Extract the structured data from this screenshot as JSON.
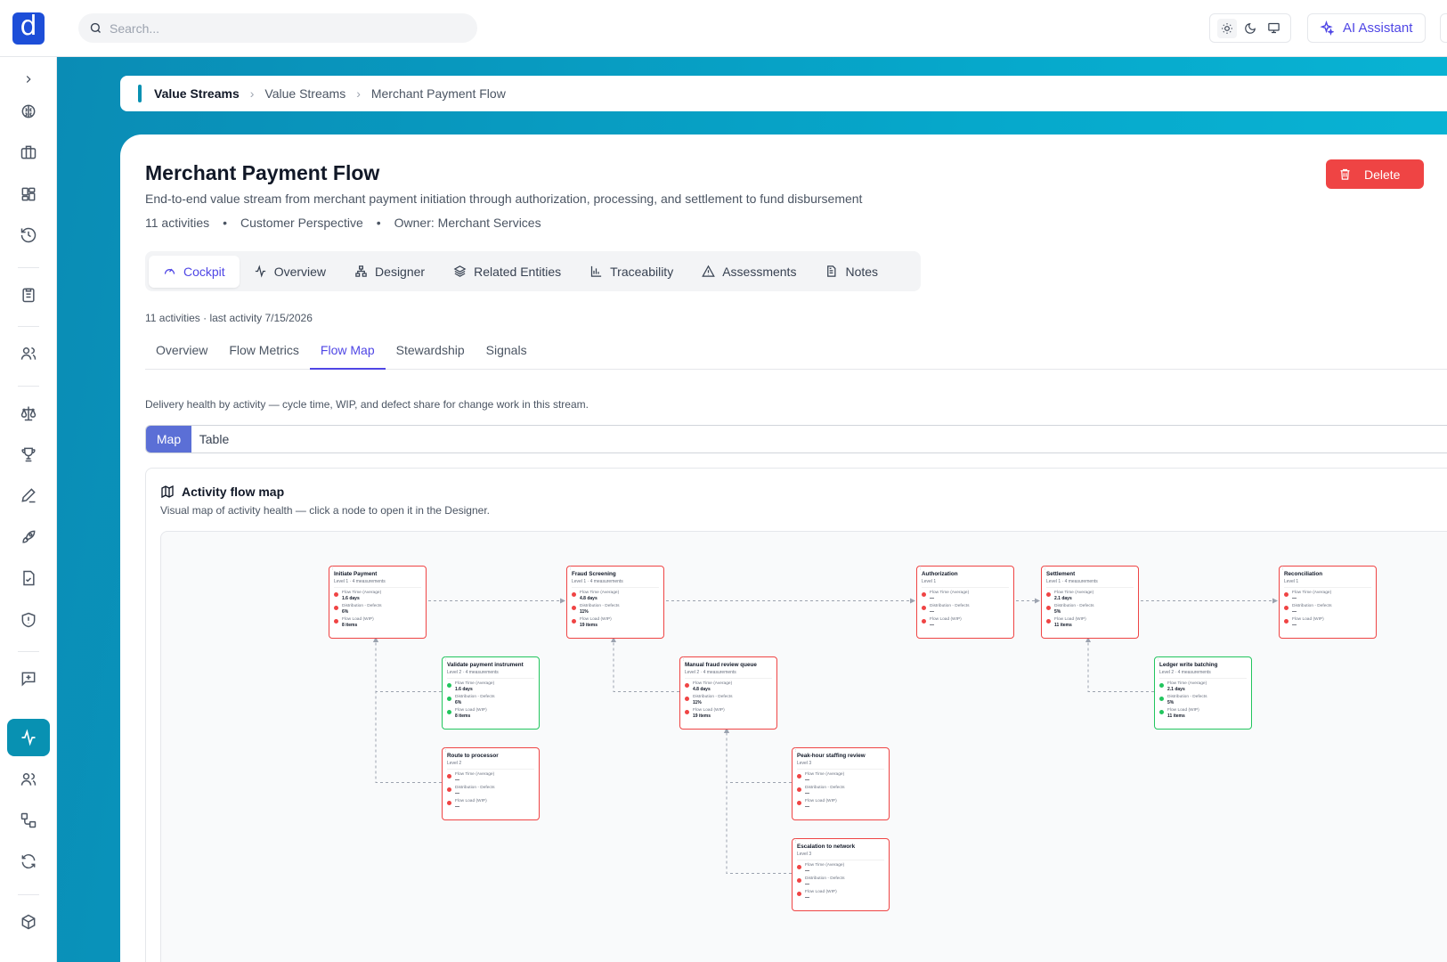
{
  "logo_letter": "d",
  "search": {
    "placeholder": "Search..."
  },
  "ai_assistant_label": "AI Assistant",
  "breadcrumb": {
    "root": "Value Streams",
    "items": [
      "Value Streams",
      "Merchant Payment Flow"
    ]
  },
  "page": {
    "title": "Merchant Payment Flow",
    "description": "End-to-end value stream from merchant payment initiation through authorization, processing, and settlement to fund disbursement",
    "meta": {
      "activities": "11 activities",
      "perspective": "Customer Perspective",
      "owner": "Owner: Merchant Services",
      "separator": "•"
    },
    "delete_label": "Delete"
  },
  "main_tabs": [
    {
      "label": "Cockpit",
      "icon": "gauge-icon",
      "active": true
    },
    {
      "label": "Overview",
      "icon": "activity-icon"
    },
    {
      "label": "Designer",
      "icon": "hierarchy-icon"
    },
    {
      "label": "Related Entities",
      "icon": "layers-icon"
    },
    {
      "label": "Traceability",
      "icon": "bar-chart-icon"
    },
    {
      "label": "Assessments",
      "icon": "warning-icon"
    },
    {
      "label": "Notes",
      "icon": "document-icon"
    }
  ],
  "cockpit": {
    "sub_meta": "11 activities  · last activity 7/15/2026",
    "sub_tabs": [
      "Overview",
      "Flow Metrics",
      "Flow Map",
      "Stewardship",
      "Signals"
    ],
    "active_sub_tab": "Flow Map",
    "health_desc": "Delivery health by activity — cycle time, WIP, and defect share for change work in this stream.",
    "view_toggle": [
      "Map",
      "Table"
    ],
    "map": {
      "title": "Activity flow map",
      "subtitle": "Visual map of activity health — click a node to open it in the Designer.",
      "metric_labels": {
        "flow_time": "Flow Time (Average)",
        "defects": "Distribution - Defects",
        "wip": "Flow Load (WIP)"
      },
      "nodes": [
        {
          "title": "Initiate Payment",
          "level": "Level 1 · 4 measurements",
          "status": "red",
          "flow_time": "1.6 days",
          "defects": "6%",
          "wip": "8 items"
        },
        {
          "title": "Fraud Screening",
          "level": "Level 1 · 4 measurements",
          "status": "red",
          "flow_time": "4.8 days",
          "defects": "11%",
          "wip": "19 items"
        },
        {
          "title": "Authorization",
          "level": "Level 1",
          "status": "red",
          "flow_time": "—",
          "defects": "—",
          "wip": "—"
        },
        {
          "title": "Settlement",
          "level": "Level 1 · 4 measurements",
          "status": "red",
          "flow_time": "2.1 days",
          "defects": "5%",
          "wip": "11 items"
        },
        {
          "title": "Reconciliation",
          "level": "Level 1",
          "status": "red",
          "flow_time": "—",
          "defects": "—",
          "wip": "—"
        },
        {
          "title": "Validate payment instrument",
          "level": "Level 2 · 4 measurements",
          "status": "green",
          "flow_time": "1.6 days",
          "defects": "6%",
          "wip": "8 items"
        },
        {
          "title": "Manual fraud review queue",
          "level": "Level 2 · 4 measurements",
          "status": "red",
          "flow_time": "4.8 days",
          "defects": "11%",
          "wip": "19 items"
        },
        {
          "title": "Ledger write batching",
          "level": "Level 2 · 4 measurements",
          "status": "green",
          "flow_time": "2.1 days",
          "defects": "5%",
          "wip": "11 items"
        },
        {
          "title": "Route to processor",
          "level": "Level 2",
          "status": "red",
          "flow_time": "—",
          "defects": "—",
          "wip": "—"
        },
        {
          "title": "Peak-hour staffing review",
          "level": "Level 3",
          "status": "red",
          "flow_time": "—",
          "defects": "—",
          "wip": "—"
        },
        {
          "title": "Escalation to network",
          "level": "Level 3",
          "status": "red",
          "flow_time": "—",
          "defects": "—",
          "wip": "—"
        }
      ]
    }
  },
  "colors": {
    "accent": "#4f46e5",
    "brand": "#0891b2",
    "danger": "#ef4444",
    "ok": "#22c55e",
    "logo": "#1d4ed8"
  },
  "sidebar_icons": [
    "chevron-right-icon",
    "brain-icon",
    "briefcase-icon",
    "dashboard-icon",
    "history-icon",
    "clipboard-icon",
    "users-icon",
    "scale-icon",
    "trophy-icon",
    "pen-icon",
    "rocket-icon",
    "file-check-icon",
    "shield-alert-icon",
    "message-plus-icon",
    "activity-icon",
    "team-icon",
    "workflow-icon",
    "refresh-icon",
    "package-icon"
  ]
}
